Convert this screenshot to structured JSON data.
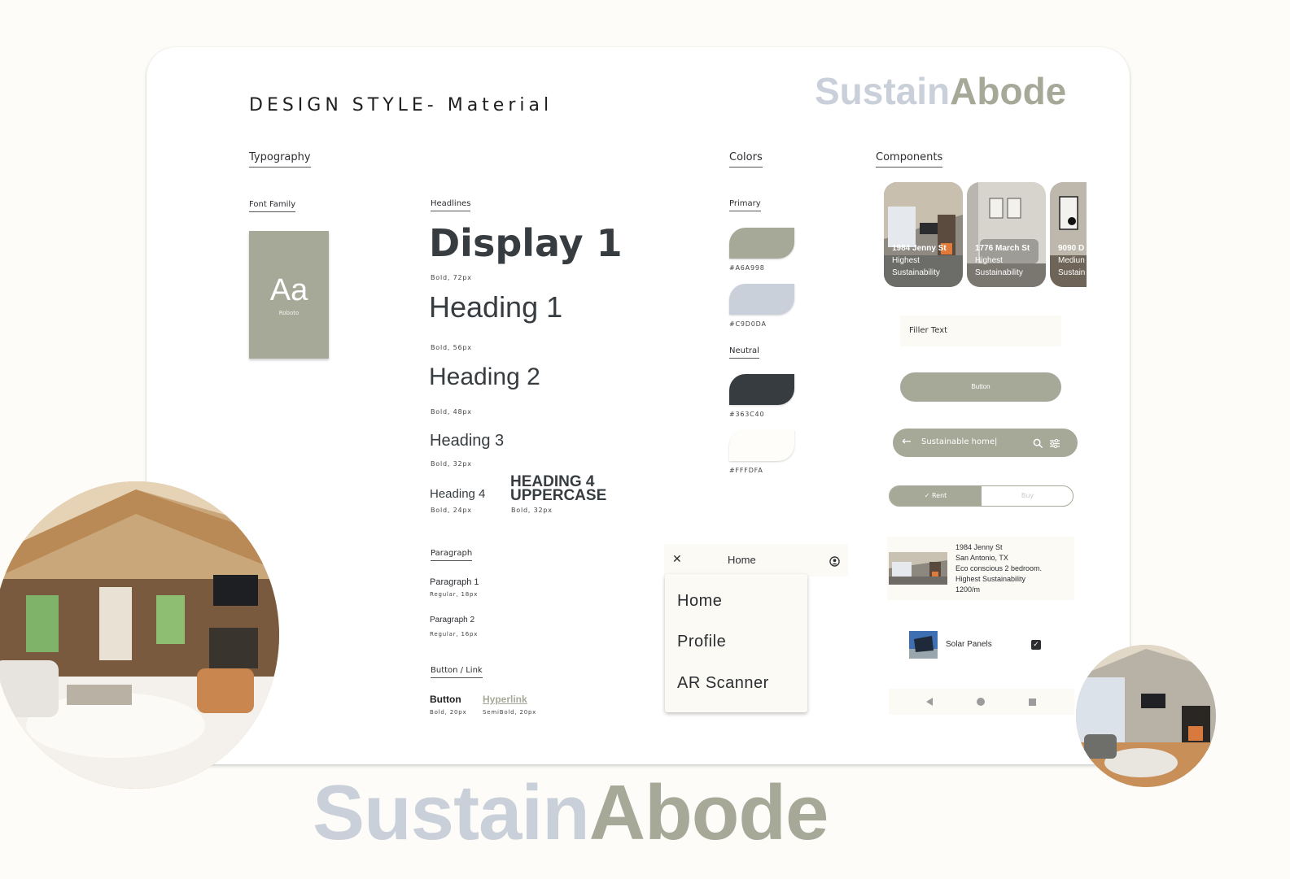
{
  "header": {
    "title": "DESIGN STYLE- Material",
    "logo_part1": "Sustain",
    "logo_part2": "Abode"
  },
  "typography": {
    "section": "Typography",
    "font_family_label": "Font Family",
    "font_sample": "Aa",
    "font_name": "Roboto",
    "headlines_label": "Headlines",
    "display1": "Display 1",
    "display1_meta": "Bold, 72px",
    "h1": "Heading 1",
    "h1_meta": "Bold, 56px",
    "h2": "Heading 2",
    "h2_meta": "Bold, 48px",
    "h3": "Heading 3",
    "h3_meta": "Bold, 32px",
    "h4": "Heading 4",
    "h4_meta": "Bold, 24px",
    "h4_upper_line1": "HEADING 4",
    "h4_upper_line2": "UPPERCASE",
    "h4_upper_meta": "Bold, 32px",
    "paragraph_label": "Paragraph",
    "p1": "Paragraph 1",
    "p1_meta": "Regular, 18px",
    "p2": "Paragraph 2",
    "p2_meta": "Regular, 16px",
    "button_link_label": "Button / Link",
    "button": "Button",
    "button_meta": "Bold, 20px",
    "hyperlink": "Hyperlink",
    "hyperlink_meta": "SemiBold, 20px"
  },
  "colors": {
    "section": "Colors",
    "primary_label": "Primary",
    "neutral_label": "Neutral",
    "swatches": [
      "#A6A998",
      "#C9D0DA",
      "#363C40",
      "#FFFDFA"
    ]
  },
  "components": {
    "section": "Components",
    "cards": [
      {
        "line1": "1984 Jenny St",
        "line2": "Highest",
        "line3": "Sustainability"
      },
      {
        "line1": "1776 March St",
        "line2": "Highest",
        "line3": "Sustainability"
      },
      {
        "line1": "9090 D",
        "line2": "Mediun",
        "line3": "Sustain"
      }
    ],
    "filler": "Filler Text",
    "button": "Button",
    "search_text": "Sustainable home|",
    "toggle_left": "Rent",
    "toggle_right": "Buy",
    "listing": [
      "1984 Jenny St",
      "San Antonio, TX",
      "Eco conscious 2 bedroom.",
      "Highest Sustainability",
      "1200/m"
    ],
    "solar": "Solar Panels"
  },
  "menu": {
    "appbar_title": "Home",
    "items": [
      "Home",
      "Profile",
      "AR Scanner"
    ]
  },
  "palette": {
    "sage": "#A6A998",
    "blue_grey": "#C9D0DA",
    "charcoal": "#363C40",
    "cream": "#FFFDFA"
  }
}
